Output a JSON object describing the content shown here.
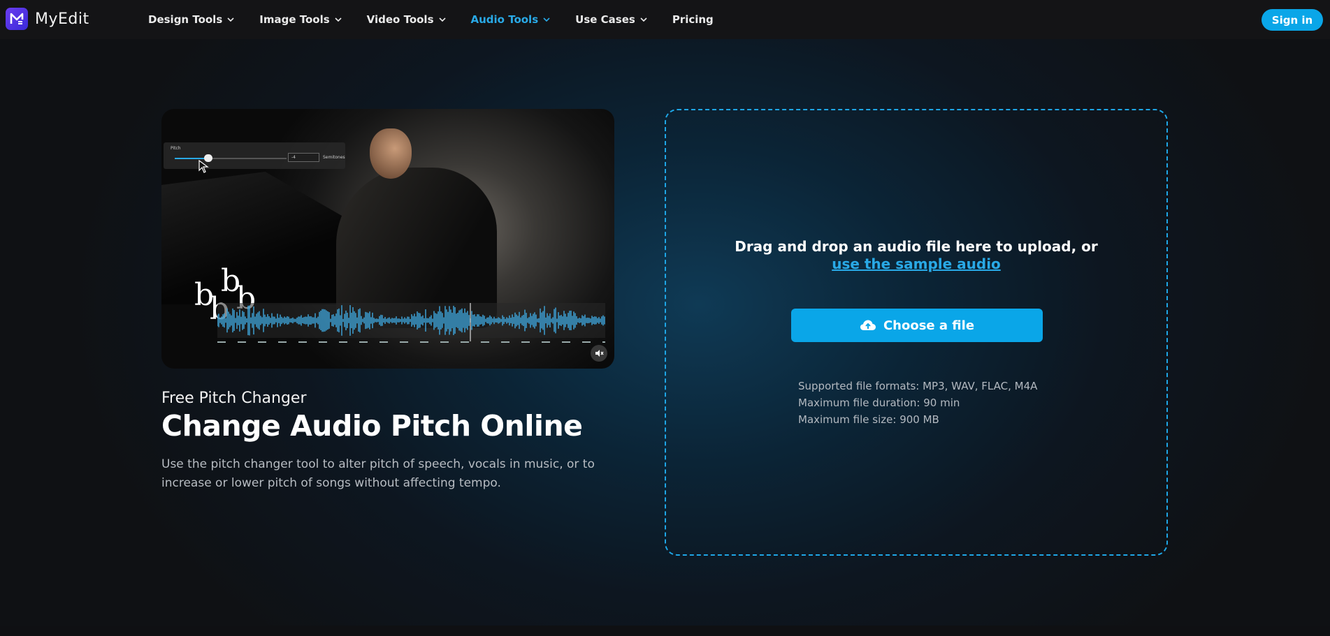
{
  "nav": {
    "brand": "MyEdit",
    "items": [
      {
        "label": "Design Tools",
        "has_dropdown": true,
        "active": false
      },
      {
        "label": "Image Tools",
        "has_dropdown": true,
        "active": false
      },
      {
        "label": "Video Tools",
        "has_dropdown": true,
        "active": false
      },
      {
        "label": "Audio Tools",
        "has_dropdown": true,
        "active": true
      },
      {
        "label": "Use Cases",
        "has_dropdown": true,
        "active": false
      },
      {
        "label": "Pricing",
        "has_dropdown": false,
        "active": false
      }
    ],
    "signin_label": "Sign in",
    "accent_color": "#29a9e6"
  },
  "preview": {
    "pitch_label": "Pitch",
    "pitch_value": "-4",
    "pitch_unit": "Semitones",
    "pitch_level": 0.3,
    "flats": [
      "b",
      "b",
      "b",
      "b"
    ],
    "icons": [
      "cursor-icon",
      "mute-icon"
    ]
  },
  "hero": {
    "subtitle": "Free Pitch Changer",
    "title": "Change Audio Pitch Online",
    "description": "Use the pitch changer tool to alter pitch of speech, vocals in music, or to increase or lower pitch of songs without affecting tempo."
  },
  "upload": {
    "prompt": "Drag and drop an audio file here to upload, or",
    "sample_link": "use the sample audio",
    "button_label": "Choose a file",
    "button_icon": "cloud-upload-icon",
    "formats": "Supported file formats: MP3, WAV, FLAC, M4A",
    "duration": "Maximum file duration: 90 min",
    "size": "Maximum file size: 900 MB"
  }
}
